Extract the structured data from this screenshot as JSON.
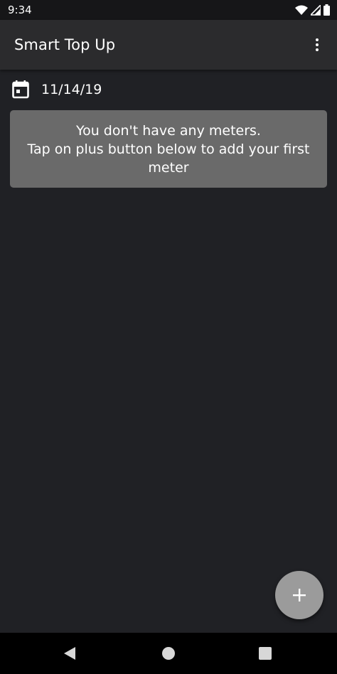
{
  "status_bar": {
    "time": "9:34",
    "icons": [
      "wifi-icon",
      "cell-signal-icon",
      "battery-icon"
    ]
  },
  "app_bar": {
    "title": "Smart Top Up",
    "overflow_icon": "more-vert-icon"
  },
  "date_row": {
    "icon": "calendar-icon",
    "date": "11/14/19"
  },
  "empty_state": {
    "line1": "You don't have any meters.",
    "line2": "Tap on plus button below to add your first",
    "line3": "meter"
  },
  "fab": {
    "icon": "plus-icon"
  },
  "nav_bar": {
    "icons": [
      "back-icon",
      "home-icon",
      "recents-icon"
    ]
  },
  "colors": {
    "background": "#202125",
    "app_bar": "#2b2b2d",
    "card": "#6a6a6a",
    "fab": "#9b9b9b"
  }
}
